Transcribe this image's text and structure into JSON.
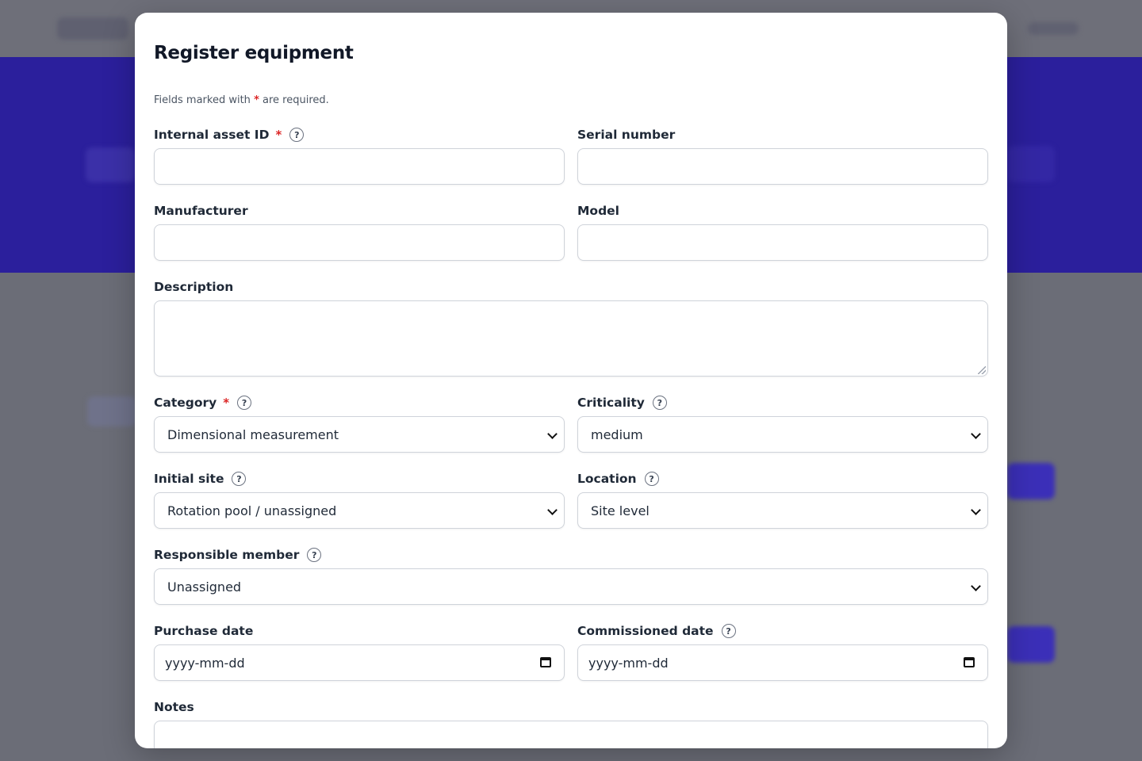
{
  "modal": {
    "title": "Register equipment",
    "required_note_prefix": "Fields marked with",
    "required_note_star": "*",
    "required_note_suffix": "are required."
  },
  "fields": {
    "internal_asset_id": {
      "label": "Internal asset ID",
      "required": "*",
      "value": ""
    },
    "serial_number": {
      "label": "Serial number",
      "value": ""
    },
    "manufacturer": {
      "label": "Manufacturer",
      "value": ""
    },
    "model": {
      "label": "Model",
      "value": ""
    },
    "description": {
      "label": "Description",
      "value": ""
    },
    "category": {
      "label": "Category",
      "required": "*",
      "selected": "Dimensional measurement"
    },
    "criticality": {
      "label": "Criticality",
      "selected": "medium"
    },
    "initial_site": {
      "label": "Initial site",
      "selected": "Rotation pool / unassigned"
    },
    "location": {
      "label": "Location",
      "selected": "Site level"
    },
    "responsible_member": {
      "label": "Responsible member",
      "selected": "Unassigned"
    },
    "purchase_date": {
      "label": "Purchase date",
      "placeholder": "yyyy-mm-dd"
    },
    "commissioned_date": {
      "label": "Commissioned date",
      "placeholder": "yyyy-mm-dd"
    },
    "notes": {
      "label": "Notes",
      "value": ""
    }
  },
  "help_glyph": "?"
}
